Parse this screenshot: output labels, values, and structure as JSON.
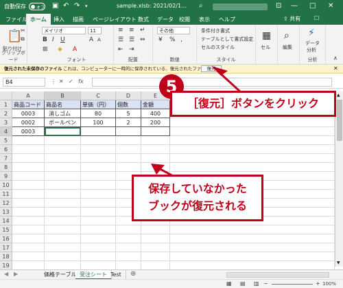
{
  "titlebar": {
    "autosave": "自動保存",
    "toggle_state": "オフ",
    "file_name": "sample.xlsb: 2021/02/1…",
    "window_buttons": [
      "—",
      "□",
      "✕"
    ]
  },
  "tabs": [
    {
      "label": "ファイル"
    },
    {
      "label": "ホーム"
    },
    {
      "label": "挿入"
    },
    {
      "label": "描画"
    },
    {
      "label": "ページレイアウト"
    },
    {
      "label": "数式"
    },
    {
      "label": "データ"
    },
    {
      "label": "校閲"
    },
    {
      "label": "表示"
    },
    {
      "label": "ヘルプ"
    }
  ],
  "share_label": "共有",
  "ribbon": {
    "clipboard": {
      "paste": "貼り付け",
      "label": "クリップボード"
    },
    "font": {
      "name": "メイリオ",
      "size": "11",
      "bold": "B",
      "italic": "I",
      "underline": "U",
      "grow": "A",
      "shrink": "A",
      "label": "フォント"
    },
    "alignment": {
      "label": "配置"
    },
    "number": {
      "format": "その他",
      "percent": "%",
      "label": "数値"
    },
    "styles": {
      "conditional": "条件付き書式",
      "table": "テーブルとして書式設定",
      "cell_styles": "セルのスタイル",
      "label": "スタイル"
    },
    "cells": {
      "label": "セル"
    },
    "editing": {
      "label": "編集"
    },
    "analyze": {
      "line1": "データ",
      "line2": "分析",
      "label": "分析"
    }
  },
  "message_bar": {
    "title": "復元された未保存のファイル",
    "text": "これは、コンピューターに一時的に保存されている、復元されたファイルです。",
    "restore": "復元"
  },
  "formula_bar": {
    "name_box": "B4",
    "fx": "fx",
    "value": ""
  },
  "columns": [
    "A",
    "B",
    "C",
    "D",
    "E"
  ],
  "rows": [
    "1",
    "2",
    "3",
    "4",
    "5",
    "6",
    "7",
    "8",
    "9",
    "10",
    "11",
    "12",
    "13",
    "14",
    "15",
    "16",
    "17",
    "18",
    "19"
  ],
  "table": [
    [
      "商品コード",
      "商品名",
      "単価（円）",
      "個数",
      "金額"
    ],
    [
      "0003",
      "消しゴム",
      "80",
      "5",
      "400"
    ],
    [
      "0002",
      "ボールペン",
      "100",
      "2",
      "200"
    ],
    [
      "0003",
      "",
      "",
      "",
      ""
    ]
  ],
  "sheets": [
    {
      "label": "価格テーブル"
    },
    {
      "label": "受注シート"
    },
    {
      "label": "Test"
    }
  ],
  "statusbar": {
    "zoom": "100%"
  },
  "callouts": {
    "step": "5",
    "restore_hint": "［復元］ボタンをクリック",
    "note_line1": "保存していなかった",
    "note_line2": "ブックが復元される"
  }
}
